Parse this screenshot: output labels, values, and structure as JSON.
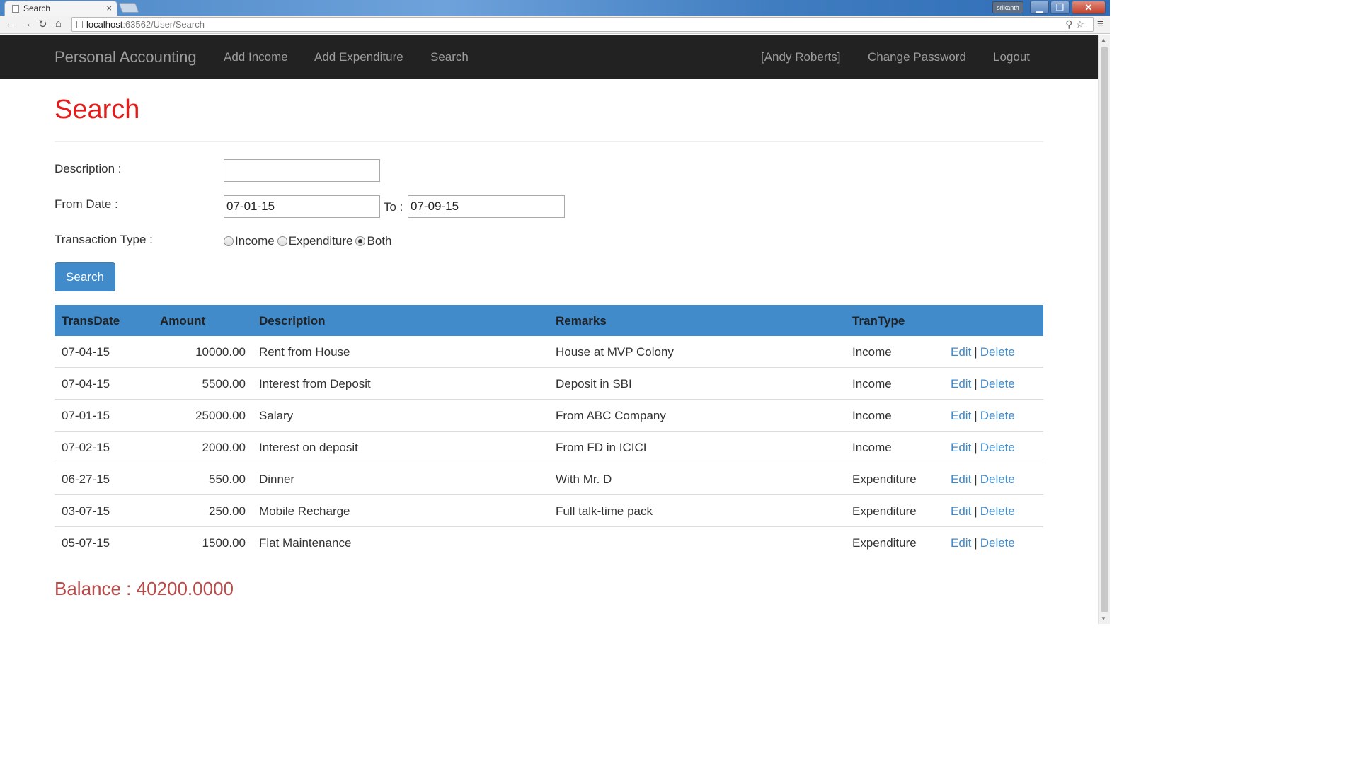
{
  "browser": {
    "tab_title": "Search",
    "tab_close": "×",
    "user_badge": "srikanth",
    "url_host": "localhost",
    "url_rest": ":63562/User/Search",
    "back_glyph": "←",
    "forward_glyph": "→",
    "reload_glyph": "↻",
    "home_glyph": "⌂",
    "zoom_glyph": "⚲",
    "star_glyph": "☆",
    "menu_glyph": "≡",
    "min_glyph": "▁",
    "max_glyph": "❐",
    "close_glyph": "✕"
  },
  "navbar": {
    "brand": "Personal Accounting",
    "left_links": [
      "Add Income",
      "Add Expenditure",
      "Search"
    ],
    "user": "[Andy Roberts]",
    "change_password": "Change Password",
    "logout": "Logout"
  },
  "page": {
    "title": "Search"
  },
  "form": {
    "description_label": "Description :",
    "description_value": "",
    "from_label": "From Date :",
    "from_value": "07-01-15",
    "to_label": "To :",
    "to_value": "07-09-15",
    "type_label": "Transaction Type :",
    "type_options": [
      "Income",
      "Expenditure",
      "Both"
    ],
    "type_selected": "Both",
    "search_button": "Search"
  },
  "table": {
    "headers": [
      "TransDate",
      "Amount",
      "Description",
      "Remarks",
      "TranType"
    ],
    "edit_label": "Edit",
    "separator": "|",
    "delete_label": "Delete",
    "rows": [
      {
        "date": "07-04-15",
        "amount": "10000.00",
        "description": "Rent from House",
        "remarks": "House at MVP Colony",
        "type": "Income"
      },
      {
        "date": "07-04-15",
        "amount": "5500.00",
        "description": "Interest from Deposit",
        "remarks": "Deposit in SBI",
        "type": "Income"
      },
      {
        "date": "07-01-15",
        "amount": "25000.00",
        "description": "Salary",
        "remarks": "From ABC Company",
        "type": "Income"
      },
      {
        "date": "07-02-15",
        "amount": "2000.00",
        "description": "Interest on deposit",
        "remarks": "From FD in ICICI",
        "type": "Income"
      },
      {
        "date": "06-27-15",
        "amount": "550.00",
        "description": "Dinner",
        "remarks": "With Mr. D",
        "type": "Expenditure"
      },
      {
        "date": "03-07-15",
        "amount": "250.00",
        "description": "Mobile Recharge",
        "remarks": "Full talk-time pack",
        "type": "Expenditure"
      },
      {
        "date": "05-07-15",
        "amount": "1500.00",
        "description": "Flat Maintenance",
        "remarks": "",
        "type": "Expenditure"
      }
    ]
  },
  "balance": "Balance : 40200.0000",
  "colors": {
    "navbar_bg": "#222222",
    "title_red": "#e31b1b",
    "primary_blue": "#428bca",
    "balance_red": "#b94a48"
  }
}
